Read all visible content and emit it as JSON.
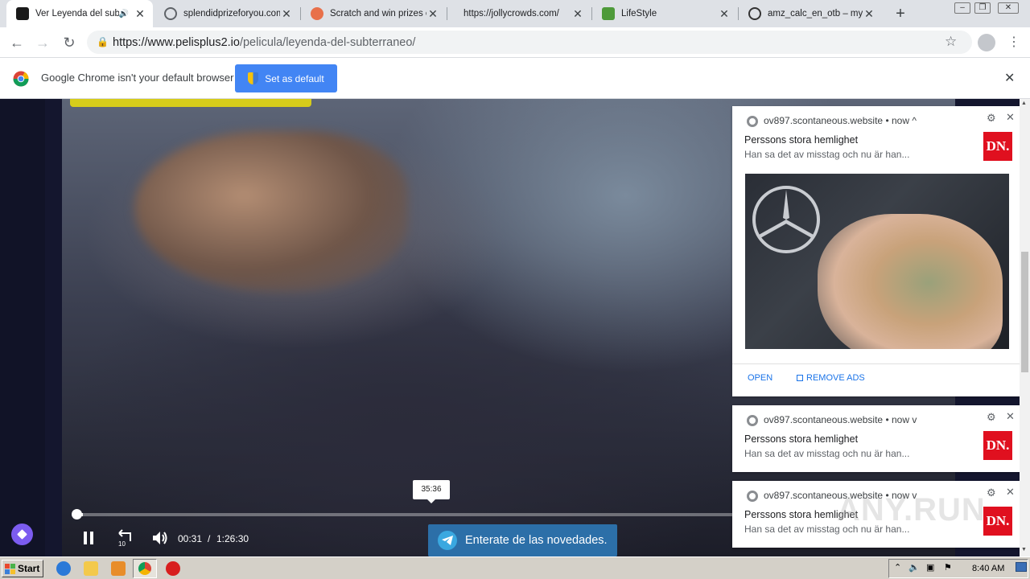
{
  "tabs": [
    {
      "title": "Ver Leyenda del sub",
      "active": true,
      "icon": "film-icon",
      "audio": true
    },
    {
      "title": "splendidprizeforyou.com",
      "active": false,
      "icon": "globe-icon"
    },
    {
      "title": "Scratch and win prizes e",
      "active": false,
      "icon": "splash-icon"
    },
    {
      "title": "https://jollycrowds.com/",
      "active": false,
      "icon": "none"
    },
    {
      "title": "LifeStyle",
      "active": false,
      "icon": "leaf-icon"
    },
    {
      "title": "amz_calc_en_otb – mysi",
      "active": false,
      "icon": "c-icon"
    }
  ],
  "address_bar": {
    "host": "https://www.pelisplus2.io",
    "path": "/pelicula/leyenda-del-subterraneo/"
  },
  "infobar": {
    "message": "Google Chrome isn't your default browser",
    "button_label": "Set as default"
  },
  "player": {
    "tooltip_time": "35:36",
    "current_time": "00:31",
    "separator": "/",
    "total_time": "1:26:30",
    "progress_fraction": 0.006,
    "telegram_label": "Enterate de las novedades."
  },
  "notifications": [
    {
      "origin": "ov897.scontaneous.website",
      "time": "now",
      "chevron": "^",
      "title": "Perssons stora hemlighet",
      "body": "Han sa det av misstag och nu är han...",
      "logo": "DN.",
      "expanded": true,
      "actions": [
        "OPEN",
        "REMOVE ADS"
      ]
    },
    {
      "origin": "ov897.scontaneous.website",
      "time": "now",
      "chevron": "v",
      "title": "Perssons stora hemlighet",
      "body": "Han sa det av misstag och nu är han...",
      "logo": "DN.",
      "expanded": false
    },
    {
      "origin": "ov897.scontaneous.website",
      "time": "now",
      "chevron": "v",
      "title": "Perssons stora hemlighet",
      "body": "Han sa det av misstag och nu är han...",
      "logo": "DN.",
      "expanded": false
    }
  ],
  "taskbar": {
    "start_label": "Start",
    "clock": "8:40 AM"
  },
  "watermark": "ANY.RUN",
  "colors": {
    "accent": "#4285f4",
    "dn_red": "#e0101f",
    "telegram": "#2c6fa8"
  }
}
